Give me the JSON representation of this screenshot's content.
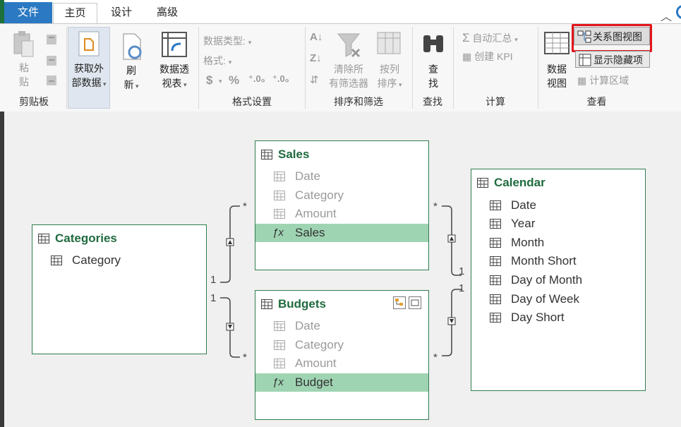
{
  "tabs": {
    "file": "文件",
    "home": "主页",
    "design": "设计",
    "advanced": "高级"
  },
  "ribbon": {
    "clipboard": {
      "paste": [
        "粘",
        "贴"
      ],
      "label": "剪贴板"
    },
    "get_external": [
      "获取外",
      "部数据"
    ],
    "refresh": [
      "刷",
      "新"
    ],
    "pivot": [
      "数据透",
      "视表"
    ],
    "formatting": {
      "datatype_label": "数据类型:",
      "format_label": "格式:",
      "currency": "$",
      "percent": "%",
      "inc_decimal": "⁺.0₀",
      "dec_decimal": "⁺.0₀",
      "label": "格式设置"
    },
    "sort_filter": {
      "clear_filters": [
        "清除所",
        "有筛选器"
      ],
      "sort_by_column": [
        "按列",
        "排序"
      ],
      "label": "排序和筛选"
    },
    "find": {
      "button": [
        "查",
        "找"
      ],
      "label": "查找"
    },
    "calc": {
      "autosum": "自动汇总",
      "create_kpi": "创建 KPI",
      "label": "计算"
    },
    "view": {
      "data_view": [
        "数据",
        "视图"
      ],
      "diagram_view": "关系图视图",
      "show_hidden": "显示隐藏项",
      "calc_area": "计算区域",
      "label": "查看"
    }
  },
  "tables": {
    "sales": {
      "title": "Sales",
      "fields": [
        "Date",
        "Category",
        "Amount"
      ],
      "measure": "Sales"
    },
    "budgets": {
      "title": "Budgets",
      "fields": [
        "Date",
        "Category",
        "Amount"
      ],
      "measure": "Budget"
    },
    "categories": {
      "title": "Categories",
      "fields": [
        "Category"
      ]
    },
    "calendar": {
      "title": "Calendar",
      "fields": [
        "Date",
        "Year",
        "Month",
        "Month Short",
        "Day of Month",
        "Day of Week",
        "Day Short"
      ]
    }
  },
  "relationships": {
    "many": "*",
    "one": "1"
  },
  "colors": {
    "accent": "#1f6b3f",
    "measure_bg": "#9fd4b3",
    "highlight": "#e4141b",
    "file_tab": "#2b79c2"
  }
}
